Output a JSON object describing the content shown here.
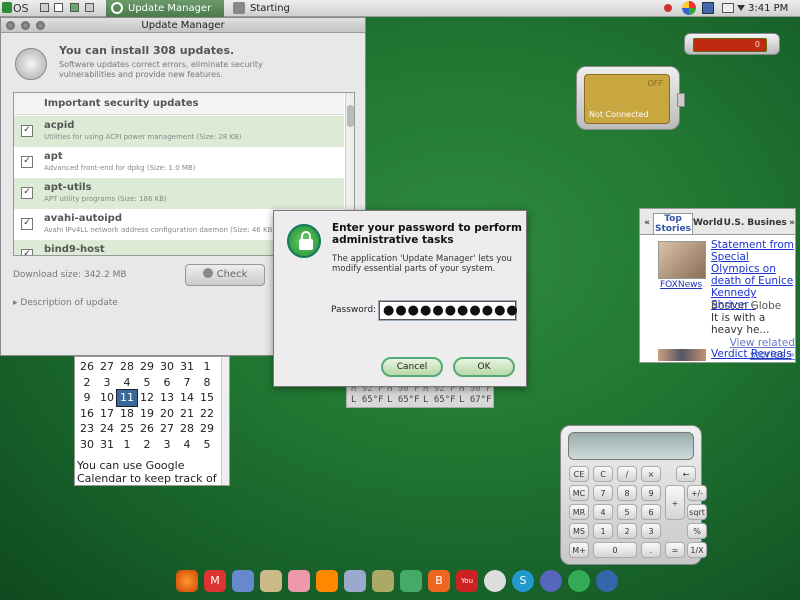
{
  "topbar": {
    "logo_text": "OS",
    "tasks": [
      {
        "label": "Update Manager"
      },
      {
        "label": "Starting Administrativ..."
      }
    ],
    "clock": "3:41 PM"
  },
  "update_manager": {
    "title": "Update Manager",
    "header": "You can install 308 updates.",
    "subtext": "Software updates correct errors, eliminate security vulnerabilities and provide new features.",
    "list_header": "Important security updates",
    "items": [
      {
        "name": "acpid",
        "desc": "Utilities for using ACPI power management (Size: 28 KB)",
        "checked": true
      },
      {
        "name": "apt",
        "desc": "Advanced front-end for dpkg (Size: 1.0 MB)",
        "checked": true
      },
      {
        "name": "apt-utils",
        "desc": "APT utility programs (Size: 186 KB)",
        "checked": true
      },
      {
        "name": "avahi-autoipd",
        "desc": "Avahi IPv4LL network address configuration daemon (Size: 46 KB)",
        "checked": true
      },
      {
        "name": "bind9-host",
        "desc": "",
        "checked": true
      }
    ],
    "download_size": "Download size: 342.2 MB",
    "check_label": "Check",
    "description_label": "Description of update"
  },
  "calendar": {
    "weeks": [
      [
        "26",
        "27",
        "28",
        "29",
        "30",
        "31",
        "1"
      ],
      [
        "2",
        "3",
        "4",
        "5",
        "6",
        "7",
        "8"
      ],
      [
        "9",
        "10",
        "11",
        "12",
        "13",
        "14",
        "15"
      ],
      [
        "16",
        "17",
        "18",
        "19",
        "20",
        "21",
        "22"
      ],
      [
        "23",
        "24",
        "25",
        "26",
        "27",
        "28",
        "29"
      ],
      [
        "30",
        "31",
        "1",
        "2",
        "3",
        "4",
        "5"
      ]
    ],
    "today": "11",
    "note": "You can use Google Calendar to keep track of all your"
  },
  "weather": {
    "highs": [
      "H 92°F",
      "H 90°F",
      "H 92°F",
      "H 90°F"
    ],
    "lows": [
      "L 65°F",
      "L 65°F",
      "L 65°F",
      "L 67°F"
    ]
  },
  "battery": {
    "value": "0"
  },
  "wifi": {
    "state": "OFF",
    "status": "Not Connected"
  },
  "news": {
    "tabs": [
      {
        "label": "«"
      },
      {
        "label": "Top Stories"
      },
      {
        "label": "World"
      },
      {
        "label": "U.S."
      },
      {
        "label": "Busines"
      },
      {
        "label": "»"
      }
    ],
    "source_logo": "FOXNews",
    "headline": "Statement from Special Olympics on death of Eunice Kennedy Shriver",
    "dash": "-",
    "source": "Boston Globe",
    "body": "It is with a heavy he...",
    "more": "View related stories »",
    "headline2": "Verdict Reveals"
  },
  "calculator": {
    "keys": [
      [
        "CE",
        "C",
        "/",
        "×",
        "←"
      ],
      [
        "MC",
        "7",
        "8",
        "9",
        "+",
        "+/-"
      ],
      [
        "MR",
        "4",
        "5",
        "6",
        "sqrt"
      ],
      [
        "MS",
        "1",
        "2",
        "3",
        "%"
      ],
      [
        "M+",
        "0",
        ".",
        "=",
        "1/X"
      ]
    ]
  },
  "dialog": {
    "title": "Enter your password to perform administrative tasks",
    "message": "The application 'Update Manager' lets you modify essential parts of your system.",
    "password_label": "Password:",
    "password_value": "●●●●●●●●●●●",
    "cancel_label": "Cancel",
    "ok_label": "OK"
  },
  "colors": {
    "desktop": "#237a33",
    "accent": "#3a6a9c",
    "battery": "#c02a10"
  }
}
